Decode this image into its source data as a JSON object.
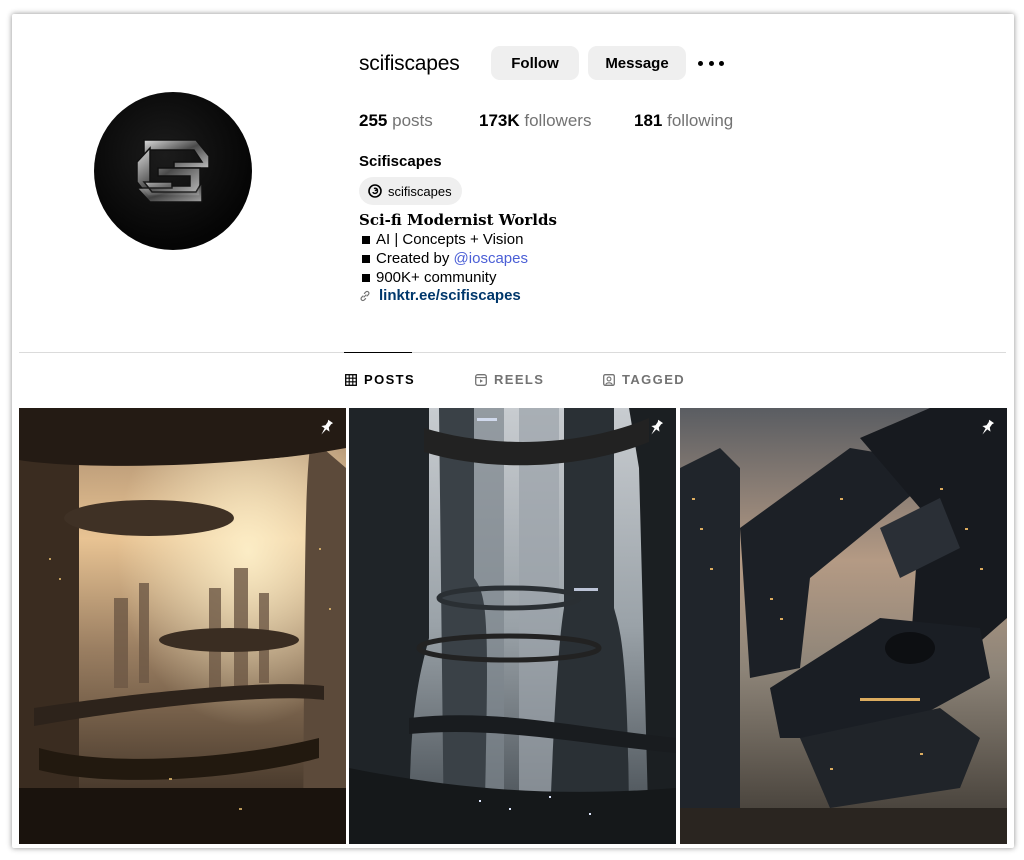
{
  "profile": {
    "username": "scifiscapes",
    "follow_label": "Follow",
    "message_label": "Message",
    "more_icon": "more-icon",
    "avatar_icon": "logo-icon",
    "stats": [
      {
        "value": "255",
        "label": "posts"
      },
      {
        "value": "173K",
        "label": "followers"
      },
      {
        "value": "181",
        "label": "following"
      }
    ],
    "full_name": "Scifiscapes",
    "threads_handle": "scifiscapes",
    "bio_title": "Sci-fi Modernist Worlds",
    "bio_lines": [
      {
        "text": "AI | Concepts + Vision"
      },
      {
        "prefix": "Created by ",
        "mention": "@ioscapes"
      },
      {
        "text": "900K+ community"
      }
    ],
    "link": "linktr.ee/scifiscapes"
  },
  "tabs": [
    {
      "label": "POSTS",
      "icon": "grid-icon",
      "active": true
    },
    {
      "label": "REELS",
      "icon": "reels-icon",
      "active": false
    },
    {
      "label": "TAGGED",
      "icon": "tagged-icon",
      "active": false
    }
  ],
  "posts": [
    {
      "pinned": true,
      "icon": "pin-icon"
    },
    {
      "pinned": true,
      "icon": "pin-icon"
    },
    {
      "pinned": true,
      "icon": "pin-icon"
    }
  ],
  "colors": {
    "button_bg": "#efefef",
    "secondary_text": "#737373",
    "link": "#00376b",
    "mention": "#4b5fd6",
    "divider": "#dbdbdb"
  }
}
